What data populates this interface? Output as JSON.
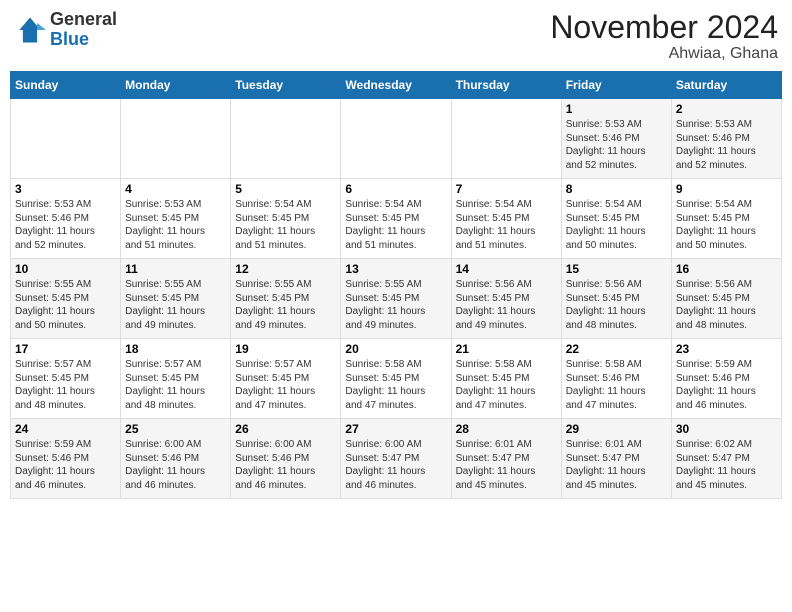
{
  "header": {
    "logo_general": "General",
    "logo_blue": "Blue",
    "title": "November 2024",
    "subtitle": "Ahwiaa, Ghana"
  },
  "days_of_week": [
    "Sunday",
    "Monday",
    "Tuesday",
    "Wednesday",
    "Thursday",
    "Friday",
    "Saturday"
  ],
  "weeks": [
    [
      {
        "day": "",
        "info": ""
      },
      {
        "day": "",
        "info": ""
      },
      {
        "day": "",
        "info": ""
      },
      {
        "day": "",
        "info": ""
      },
      {
        "day": "",
        "info": ""
      },
      {
        "day": "1",
        "info": "Sunrise: 5:53 AM\nSunset: 5:46 PM\nDaylight: 11 hours\nand 52 minutes."
      },
      {
        "day": "2",
        "info": "Sunrise: 5:53 AM\nSunset: 5:46 PM\nDaylight: 11 hours\nand 52 minutes."
      }
    ],
    [
      {
        "day": "3",
        "info": "Sunrise: 5:53 AM\nSunset: 5:46 PM\nDaylight: 11 hours\nand 52 minutes."
      },
      {
        "day": "4",
        "info": "Sunrise: 5:53 AM\nSunset: 5:45 PM\nDaylight: 11 hours\nand 51 minutes."
      },
      {
        "day": "5",
        "info": "Sunrise: 5:54 AM\nSunset: 5:45 PM\nDaylight: 11 hours\nand 51 minutes."
      },
      {
        "day": "6",
        "info": "Sunrise: 5:54 AM\nSunset: 5:45 PM\nDaylight: 11 hours\nand 51 minutes."
      },
      {
        "day": "7",
        "info": "Sunrise: 5:54 AM\nSunset: 5:45 PM\nDaylight: 11 hours\nand 51 minutes."
      },
      {
        "day": "8",
        "info": "Sunrise: 5:54 AM\nSunset: 5:45 PM\nDaylight: 11 hours\nand 50 minutes."
      },
      {
        "day": "9",
        "info": "Sunrise: 5:54 AM\nSunset: 5:45 PM\nDaylight: 11 hours\nand 50 minutes."
      }
    ],
    [
      {
        "day": "10",
        "info": "Sunrise: 5:55 AM\nSunset: 5:45 PM\nDaylight: 11 hours\nand 50 minutes."
      },
      {
        "day": "11",
        "info": "Sunrise: 5:55 AM\nSunset: 5:45 PM\nDaylight: 11 hours\nand 49 minutes."
      },
      {
        "day": "12",
        "info": "Sunrise: 5:55 AM\nSunset: 5:45 PM\nDaylight: 11 hours\nand 49 minutes."
      },
      {
        "day": "13",
        "info": "Sunrise: 5:55 AM\nSunset: 5:45 PM\nDaylight: 11 hours\nand 49 minutes."
      },
      {
        "day": "14",
        "info": "Sunrise: 5:56 AM\nSunset: 5:45 PM\nDaylight: 11 hours\nand 49 minutes."
      },
      {
        "day": "15",
        "info": "Sunrise: 5:56 AM\nSunset: 5:45 PM\nDaylight: 11 hours\nand 48 minutes."
      },
      {
        "day": "16",
        "info": "Sunrise: 5:56 AM\nSunset: 5:45 PM\nDaylight: 11 hours\nand 48 minutes."
      }
    ],
    [
      {
        "day": "17",
        "info": "Sunrise: 5:57 AM\nSunset: 5:45 PM\nDaylight: 11 hours\nand 48 minutes."
      },
      {
        "day": "18",
        "info": "Sunrise: 5:57 AM\nSunset: 5:45 PM\nDaylight: 11 hours\nand 48 minutes."
      },
      {
        "day": "19",
        "info": "Sunrise: 5:57 AM\nSunset: 5:45 PM\nDaylight: 11 hours\nand 47 minutes."
      },
      {
        "day": "20",
        "info": "Sunrise: 5:58 AM\nSunset: 5:45 PM\nDaylight: 11 hours\nand 47 minutes."
      },
      {
        "day": "21",
        "info": "Sunrise: 5:58 AM\nSunset: 5:45 PM\nDaylight: 11 hours\nand 47 minutes."
      },
      {
        "day": "22",
        "info": "Sunrise: 5:58 AM\nSunset: 5:46 PM\nDaylight: 11 hours\nand 47 minutes."
      },
      {
        "day": "23",
        "info": "Sunrise: 5:59 AM\nSunset: 5:46 PM\nDaylight: 11 hours\nand 46 minutes."
      }
    ],
    [
      {
        "day": "24",
        "info": "Sunrise: 5:59 AM\nSunset: 5:46 PM\nDaylight: 11 hours\nand 46 minutes."
      },
      {
        "day": "25",
        "info": "Sunrise: 6:00 AM\nSunset: 5:46 PM\nDaylight: 11 hours\nand 46 minutes."
      },
      {
        "day": "26",
        "info": "Sunrise: 6:00 AM\nSunset: 5:46 PM\nDaylight: 11 hours\nand 46 minutes."
      },
      {
        "day": "27",
        "info": "Sunrise: 6:00 AM\nSunset: 5:47 PM\nDaylight: 11 hours\nand 46 minutes."
      },
      {
        "day": "28",
        "info": "Sunrise: 6:01 AM\nSunset: 5:47 PM\nDaylight: 11 hours\nand 45 minutes."
      },
      {
        "day": "29",
        "info": "Sunrise: 6:01 AM\nSunset: 5:47 PM\nDaylight: 11 hours\nand 45 minutes."
      },
      {
        "day": "30",
        "info": "Sunrise: 6:02 AM\nSunset: 5:47 PM\nDaylight: 11 hours\nand 45 minutes."
      }
    ]
  ]
}
